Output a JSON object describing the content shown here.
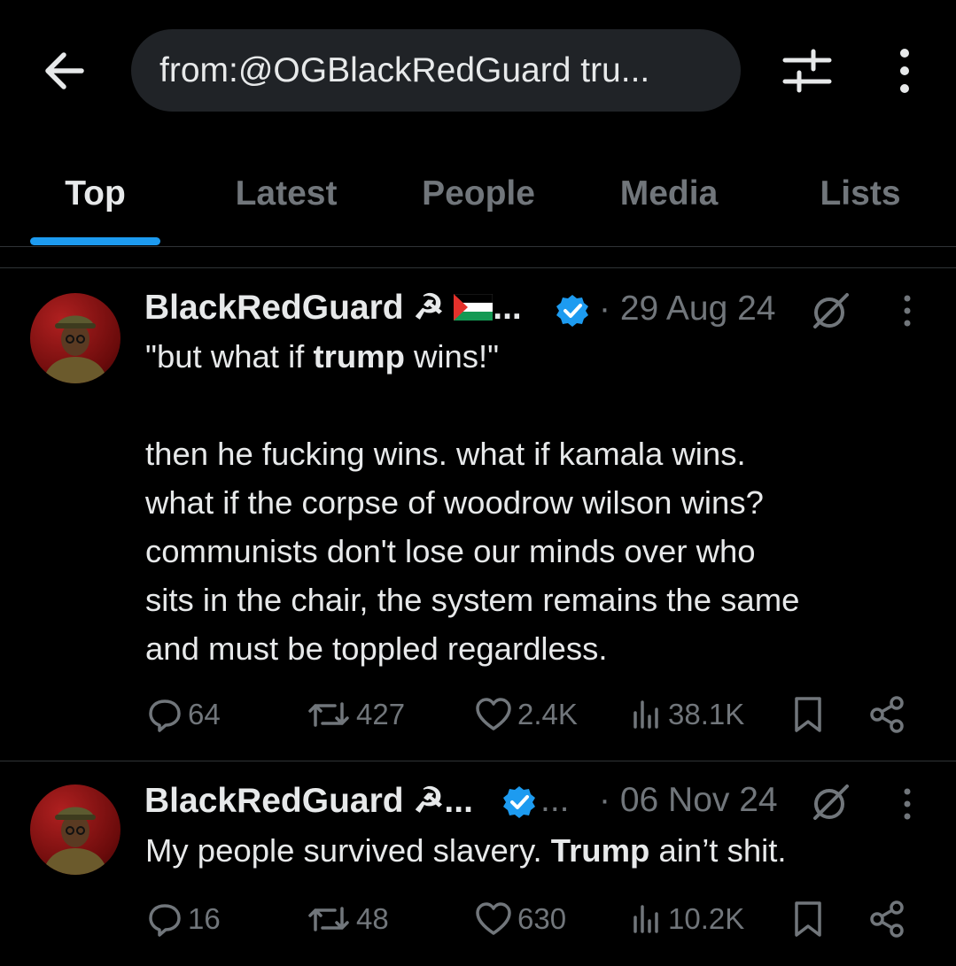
{
  "search": {
    "query": "from:@OGBlackRedGuard tru..."
  },
  "tabs": [
    "Top",
    "Latest",
    "People",
    "Media",
    "Lists"
  ],
  "tweets": [
    {
      "display_name": "BlackRedGuard ☭",
      "name_suffix": "...",
      "date": "· 29 Aug 24",
      "body_lines": [
        {
          "pre": "\"but what if ",
          "bold": "trump",
          "post": " wins!\""
        },
        {
          "pre": "",
          "bold": "",
          "post": ""
        },
        {
          "pre": "then he fucking wins. what if kamala wins.",
          "bold": "",
          "post": ""
        },
        {
          "pre": "what if the corpse of woodrow wilson wins?",
          "bold": "",
          "post": ""
        },
        {
          "pre": "communists don't lose our minds over who",
          "bold": "",
          "post": ""
        },
        {
          "pre": "sits in the chair, the system remains the same",
          "bold": "",
          "post": ""
        },
        {
          "pre": "and must be toppled regardless.",
          "bold": "",
          "post": ""
        }
      ],
      "replies": "64",
      "reposts": "427",
      "likes": "2.4K",
      "views": "38.1K"
    },
    {
      "display_name": "BlackRedGuard ☭...",
      "name_suffix": "...",
      "date": "· 06 Nov 24",
      "body_lines": [
        {
          "pre": "My people survived slavery. ",
          "bold": "Trump",
          "post": " ain’t shit."
        }
      ],
      "replies": "16",
      "reposts": "48",
      "likes": "630",
      "views": "10.2K"
    }
  ],
  "colors": {
    "accent": "#1d9bf0",
    "muted": "#71767b",
    "text": "#e7e9ea",
    "divider": "#2f3336",
    "verified": "#1d9bf0"
  }
}
